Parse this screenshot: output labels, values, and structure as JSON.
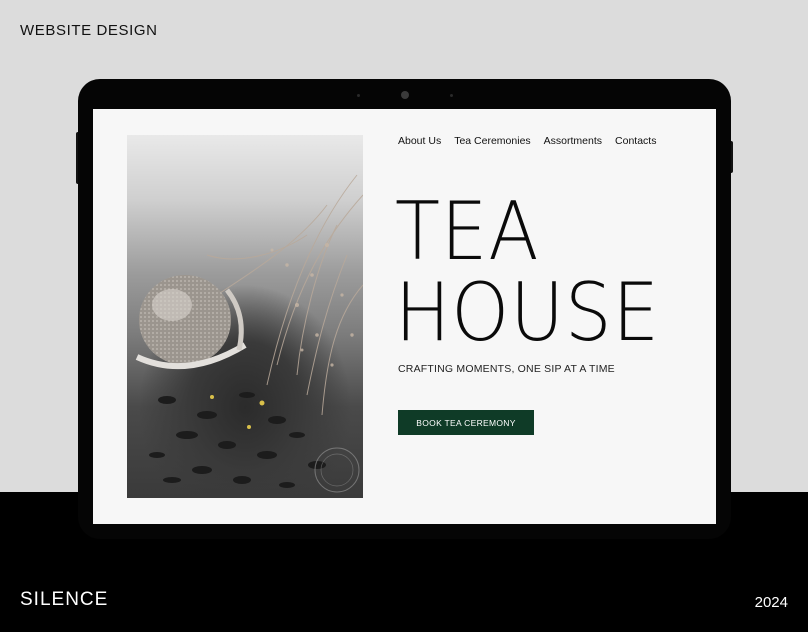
{
  "header": {
    "label": "WEBSITE DESIGN"
  },
  "footer": {
    "brand": "SILENCE",
    "year": "2024"
  },
  "site": {
    "nav": [
      "About Us",
      "Tea Ceremonies",
      "Assortments",
      "Contacts"
    ],
    "hero": {
      "title_line1": "TEA",
      "title_line2": "HOUSE",
      "tagline": "CRAFTING MOMENTS, ONE SIP AT A TIME",
      "cta_label": "BOOK TEA CEREMONY"
    },
    "image": {
      "icon": "tea-infuser-photo"
    }
  },
  "colors": {
    "background": "#dcdcdc",
    "band": "#000000",
    "screen": "#f7f7f7",
    "cta": "#0f3b27"
  }
}
